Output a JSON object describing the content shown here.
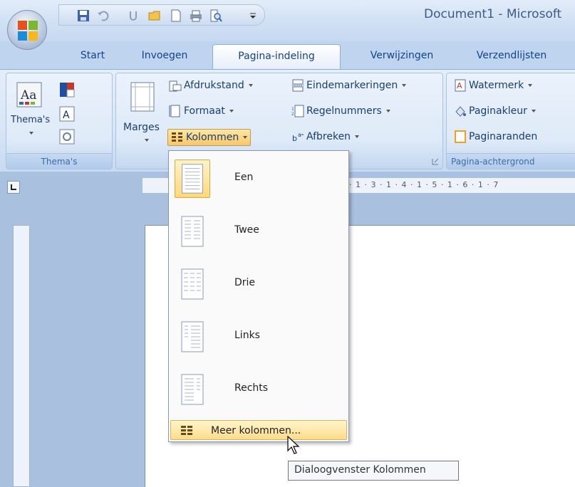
{
  "window": {
    "title": "Document1 - Microsoft"
  },
  "quick_access": {
    "icons": [
      "save-icon",
      "undo-icon",
      "redo-icon",
      "open-icon",
      "new-icon",
      "print-icon",
      "print-preview-icon",
      "customize-icon"
    ]
  },
  "tabs": [
    {
      "label": "Start"
    },
    {
      "label": "Invoegen"
    },
    {
      "label": "Pagina-indeling"
    },
    {
      "label": "Verwijzingen"
    },
    {
      "label": "Verzendlijsten"
    }
  ],
  "ribbon": {
    "themes": {
      "button_label": "Thema's",
      "group_label": "Thema's"
    },
    "page_setup": {
      "margins_label": "Marges",
      "orientation_label": "Afdrukstand",
      "size_label": "Formaat",
      "columns_label": "Kolommen",
      "breaks_label": "Eindemarkeringen",
      "line_numbers_label": "Regelnummers",
      "hyphenation_label": "Afbreken"
    },
    "page_background": {
      "watermark_label": "Watermerk",
      "page_color_label": "Paginakleur",
      "page_borders_label": "Paginaranden",
      "group_label": "Pagina-achtergrond"
    }
  },
  "ruler": {
    "ticks": "· 1 · 3 · 1 · 4 · 1 · 5 · 1 · 6 · 1 · 7"
  },
  "columns_menu": {
    "items": [
      {
        "label": "Een"
      },
      {
        "label": "Twee"
      },
      {
        "label": "Drie"
      },
      {
        "label": "Links"
      },
      {
        "label": "Rechts"
      }
    ],
    "more_label": "Meer kolommen...",
    "tooltip": "Dialoogvenster Kolommen"
  },
  "colors": {
    "accent": "#fedc8b",
    "ribbon": "#dfeaf8",
    "workspace": "#a9c0de"
  }
}
